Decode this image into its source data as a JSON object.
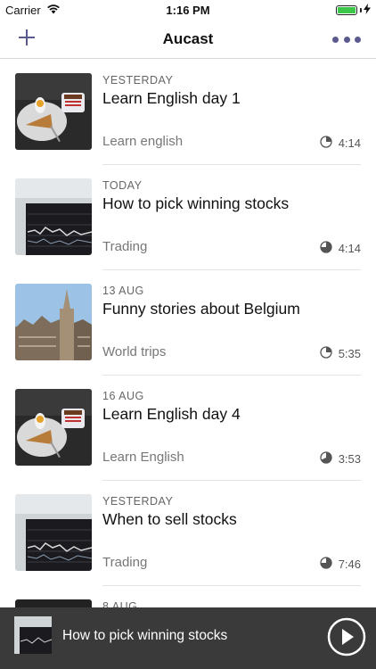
{
  "status_bar": {
    "carrier": "Carrier",
    "time": "1:16 PM"
  },
  "nav": {
    "title": "Aucast"
  },
  "episodes": [
    {
      "date": "YESTERDAY",
      "title": "Learn English day 1",
      "category": "Learn english",
      "duration": "4:14",
      "thumb": "breakfast"
    },
    {
      "date": "TODAY",
      "title": "How to pick winning stocks",
      "category": "Trading",
      "duration": "4:14",
      "thumb": "chart"
    },
    {
      "date": "13 AUG",
      "title": "Funny stories about Belgium",
      "category": "World trips",
      "duration": "5:35",
      "thumb": "city"
    },
    {
      "date": "16 AUG",
      "title": "Learn English day 4",
      "category": "Learn English",
      "duration": "3:53",
      "thumb": "breakfast"
    },
    {
      "date": "YESTERDAY",
      "title": "When to sell stocks",
      "category": "Trading",
      "duration": "7:46",
      "thumb": "chart"
    },
    {
      "date": "8 AUG",
      "title": "",
      "category": "",
      "duration": "",
      "thumb": "dark"
    }
  ],
  "player": {
    "title": "How to pick winning stocks"
  },
  "colors": {
    "accent": "#5b5a8e",
    "player_bg": "#3a3a3a"
  }
}
